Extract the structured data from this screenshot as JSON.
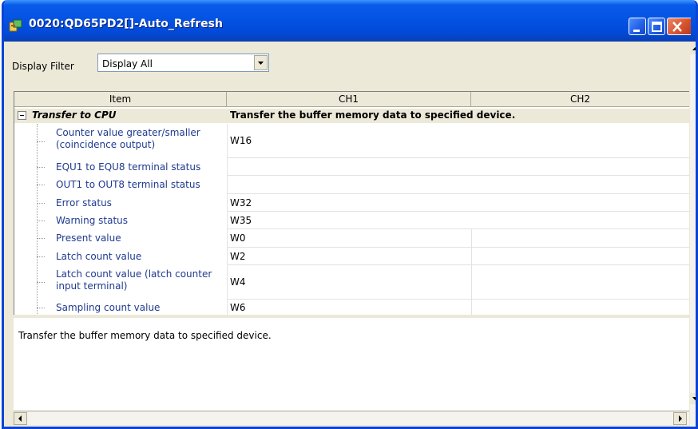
{
  "window": {
    "title": "0020:QD65PD2[]-Auto_Refresh"
  },
  "filter": {
    "label": "Display Filter",
    "value": "Display All"
  },
  "grid": {
    "columns": [
      "Item",
      "CH1",
      "CH2"
    ],
    "group": {
      "label": "Transfer to CPU",
      "description": "Transfer the buffer memory data to specified device."
    },
    "rows": [
      {
        "item": "Counter value greater/smaller (coincidence output)",
        "ch1": "W16",
        "ch2": ""
      },
      {
        "item": "EQU1 to EQU8 terminal status",
        "ch1": "",
        "ch2": ""
      },
      {
        "item": "OUT1 to OUT8 terminal status",
        "ch1": "",
        "ch2": ""
      },
      {
        "item": "Error status",
        "ch1": "W32",
        "ch2": ""
      },
      {
        "item": "Warning status",
        "ch1": "W35",
        "ch2": ""
      },
      {
        "item": "Present value",
        "ch1": "W0",
        "ch2": ""
      },
      {
        "item": "Latch count value",
        "ch1": "W2",
        "ch2": ""
      },
      {
        "item": "Latch count value (latch counter input terminal)",
        "ch1": "W4",
        "ch2": ""
      },
      {
        "item": "Sampling count value",
        "ch1": "W6",
        "ch2": ""
      }
    ]
  },
  "description": "Transfer the buffer memory data to specified device."
}
